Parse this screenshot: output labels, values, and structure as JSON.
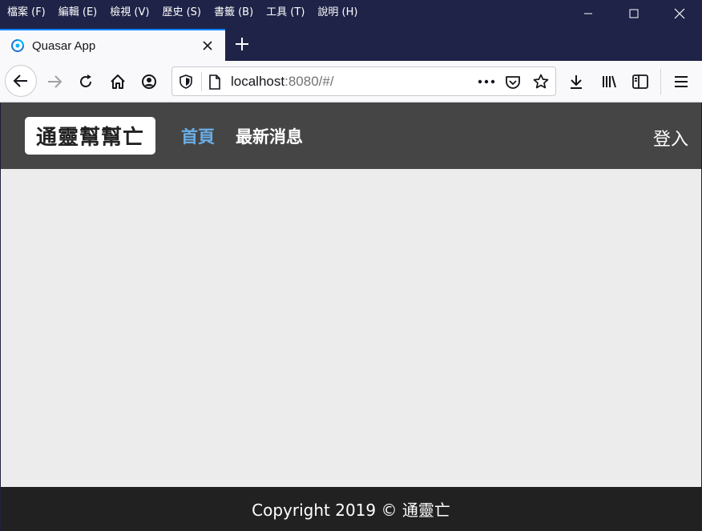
{
  "menubar": {
    "items": [
      "檔案 (F)",
      "編輯 (E)",
      "檢視 (V)",
      "歷史 (S)",
      "書籤 (B)",
      "工具 (T)",
      "說明 (H)"
    ]
  },
  "tab": {
    "title": "Quasar App"
  },
  "urlbar": {
    "host": "localhost",
    "rest": ":8080/#/"
  },
  "app": {
    "logo": "通靈幫幫亡",
    "nav": [
      "首頁",
      "最新消息"
    ],
    "login": "登入",
    "footer": "Copyright 2019 © 通靈亡",
    "colors": {
      "header_bg": "#454545",
      "active_link": "#6aaee8",
      "body_bg": "#ececec",
      "footer_bg": "#212121"
    }
  }
}
